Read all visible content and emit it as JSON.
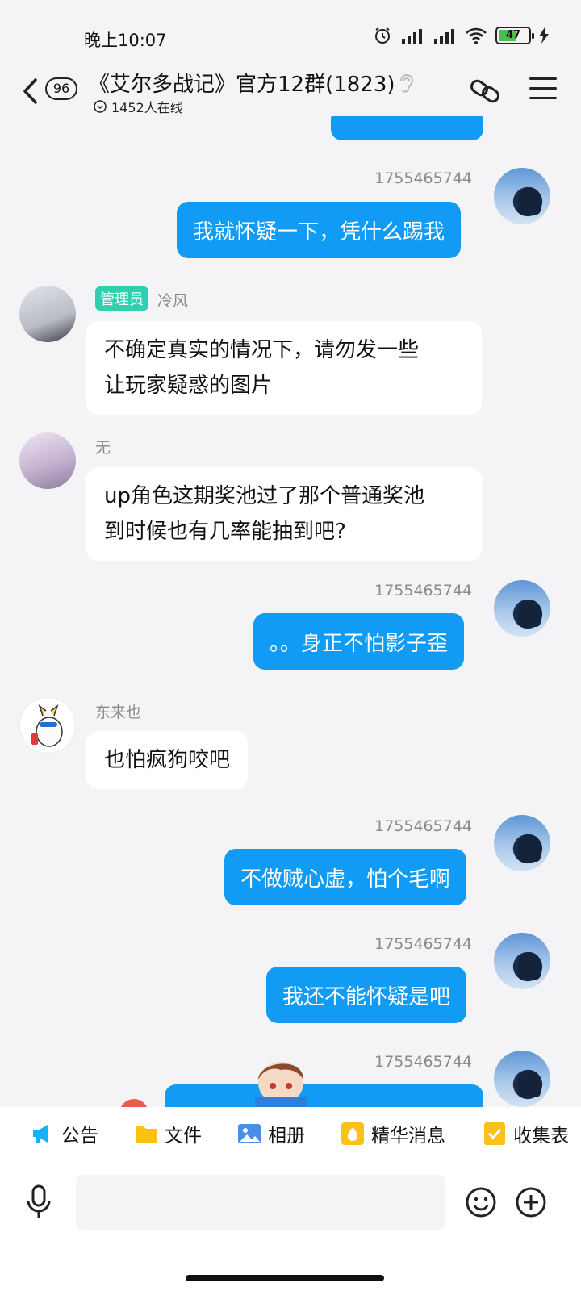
{
  "status_bar": {
    "time": "晚上10:07",
    "battery_level": "47",
    "network_label": "HD"
  },
  "header": {
    "unread_count": "96",
    "group_title": "《艾尔多战记》官方12群(1823)",
    "online_text": "1452人在线"
  },
  "messages": [
    {
      "side": "out",
      "sender": "1755465744",
      "text": "我就怀疑一下，凭什么踢我"
    },
    {
      "side": "in",
      "sender": "冷风",
      "tag": "管理员",
      "text_lines": [
        "不确定真实的情况下，请勿发一些",
        "让玩家疑惑的图片"
      ]
    },
    {
      "side": "in",
      "sender": "无",
      "text_lines": [
        "up角色这期奖池过了那个普通奖池",
        "到时候也有几率能抽到吧?"
      ]
    },
    {
      "side": "out",
      "sender": "1755465744",
      "text": "。。身正不怕影子歪"
    },
    {
      "side": "in",
      "sender": "东来也",
      "text": "也怕疯狗咬吧"
    },
    {
      "side": "out",
      "sender": "1755465744",
      "text": "不做贼心虚，怕个毛啊"
    },
    {
      "side": "out",
      "sender": "1755465744",
      "text": "我还不能怀疑是吧"
    },
    {
      "side": "out",
      "sender": "1755465744",
      "text": ""
    }
  ],
  "toolbar": {
    "items": [
      "公告",
      "文件",
      "相册",
      "精华消息",
      "收集表"
    ]
  },
  "input": {
    "placeholder": "",
    "value": ""
  },
  "colors": {
    "outgoing_bubble": "#129bf5",
    "incoming_bubble": "#ffffff",
    "admin_tag": "#2ed0b0",
    "background": "#f4f4f6"
  },
  "icons": [
    "back-icon",
    "ear-icon",
    "link-icon",
    "menu-icon",
    "megaphone-icon",
    "folder-icon",
    "photo-icon",
    "essence-icon",
    "form-icon",
    "mic-icon",
    "emoji-icon",
    "plus-icon"
  ]
}
